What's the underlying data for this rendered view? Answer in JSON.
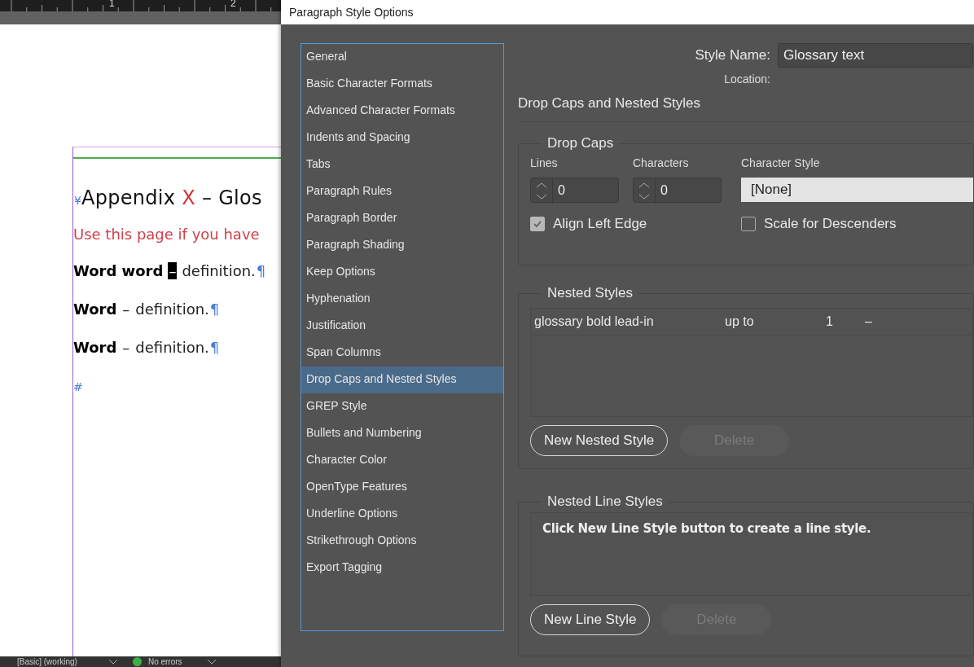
{
  "ruler": {
    "labels": [
      "1",
      "2"
    ]
  },
  "document": {
    "anchor_mark": "¥",
    "heading_before": "Appendix",
    "heading_highlight": "X",
    "heading_after": "– Glos",
    "intro": "Use this page if you have",
    "entries": [
      {
        "term": "Word word",
        "separator": "–",
        "definition": "definition.",
        "pilcrow": "¶",
        "highlighted": true
      },
      {
        "term": "Word",
        "separator": "–",
        "definition": "definition.",
        "pilcrow": "¶",
        "highlighted": false
      },
      {
        "term": "Word",
        "separator": "–",
        "definition": "definition.",
        "pilcrow": "¶",
        "highlighted": false
      }
    ],
    "end_mark": "#"
  },
  "status_bar": {
    "style": "[Basic] (working)",
    "errors": "No errors"
  },
  "dialog": {
    "title": "Paragraph Style Options",
    "categories": [
      {
        "label": "General",
        "selected": false
      },
      {
        "label": "Basic Character Formats",
        "selected": false
      },
      {
        "label": "Advanced Character Formats",
        "selected": false
      },
      {
        "label": "Indents and Spacing",
        "selected": false
      },
      {
        "label": "Tabs",
        "selected": false
      },
      {
        "label": "Paragraph Rules",
        "selected": false
      },
      {
        "label": "Paragraph Border",
        "selected": false
      },
      {
        "label": "Paragraph Shading",
        "selected": false
      },
      {
        "label": "Keep Options",
        "selected": false
      },
      {
        "label": "Hyphenation",
        "selected": false
      },
      {
        "label": "Justification",
        "selected": false
      },
      {
        "label": "Span Columns",
        "selected": false
      },
      {
        "label": "Drop Caps and Nested Styles",
        "selected": true
      },
      {
        "label": "GREP Style",
        "selected": false
      },
      {
        "label": "Bullets and Numbering",
        "selected": false
      },
      {
        "label": "Character Color",
        "selected": false
      },
      {
        "label": "OpenType Features",
        "selected": false
      },
      {
        "label": "Underline Options",
        "selected": false
      },
      {
        "label": "Strikethrough Options",
        "selected": false
      },
      {
        "label": "Export Tagging",
        "selected": false
      }
    ],
    "style_name": {
      "label": "Style Name:",
      "value": "Glossary text"
    },
    "location": {
      "label": "Location:"
    },
    "section_title": "Drop Caps and Nested Styles",
    "drop_caps": {
      "title": "Drop Caps",
      "lines": {
        "label": "Lines",
        "value": "0"
      },
      "characters": {
        "label": "Characters",
        "value": "0"
      },
      "character_style": {
        "label": "Character Style",
        "value": "[None]"
      },
      "align_left_edge": {
        "label": "Align Left Edge",
        "checked": true,
        "disabled": true
      },
      "scale_for_descenders": {
        "label": "Scale for Descenders",
        "checked": false,
        "disabled": false
      }
    },
    "nested_styles": {
      "title": "Nested Styles",
      "rows": [
        {
          "style": "glossary bold lead-in",
          "mode": "up to",
          "count": "1",
          "delimiter": "–"
        }
      ],
      "new_button": "New Nested Style",
      "delete_button": {
        "label": "Delete",
        "disabled": true
      }
    },
    "nested_line_styles": {
      "title": "Nested Line Styles",
      "message": "Click New Line Style button to create a line style.",
      "new_button": "New Line Style",
      "delete_button": {
        "label": "Delete",
        "disabled": true
      }
    }
  }
}
